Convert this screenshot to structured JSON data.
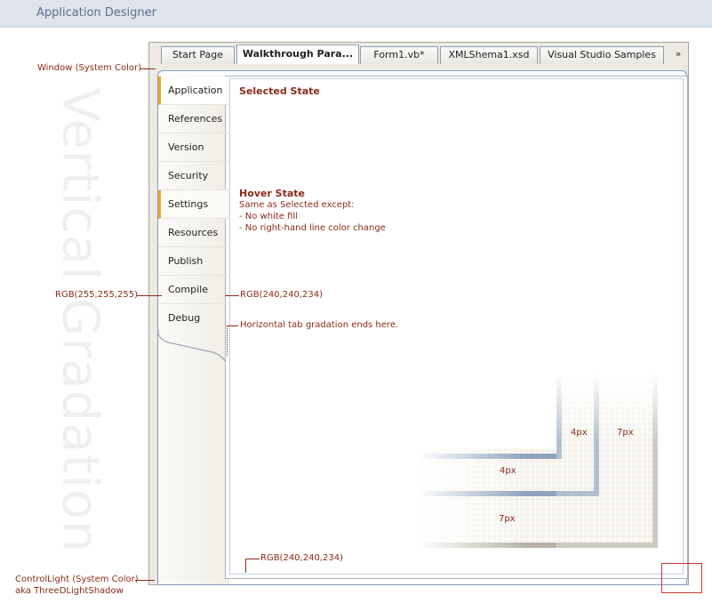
{
  "header": {
    "title": "Application Designer"
  },
  "watermark": "Vertical Gradation",
  "tabs": [
    "Start Page",
    "Walkthrough Para...",
    "Form1.vb*",
    "XMLShema1.xsd",
    "Visual Studio Samples"
  ],
  "tabs_overflow_icon": "chevron-double-down-icon",
  "side_tabs": [
    "Application",
    "References",
    "Version",
    "Security",
    "Settings",
    "Resources",
    "Publish",
    "Compile",
    "Debug"
  ],
  "selected_tab": "Application",
  "hover_tab": "Settings",
  "content": {
    "selected_title": "Selected State",
    "hover_title": "Hover State",
    "hover_desc": "Same as Selected except:",
    "hover_line1": "- No white fill",
    "hover_line2": "- No right-hand line color change"
  },
  "annotations": {
    "window": "Window (System Color)",
    "rgb_white": "RGB(255,255,255)",
    "rgb_tab": "RGB(240,240,234)",
    "gradation": "Horizontal tab gradation ends here.",
    "rgb_bottom": "RGB(240,240,234)",
    "controllight": "ControlLight (System Color)",
    "controllight2": "aka ThreeDLightShadow",
    "px_4a": "4px",
    "px_7a": "7px",
    "px_4b": "4px",
    "px_7b": "7px"
  },
  "colors": {
    "accent": "#f2a422",
    "annotation": "#8b2a19",
    "border": "#8a9ab5"
  }
}
